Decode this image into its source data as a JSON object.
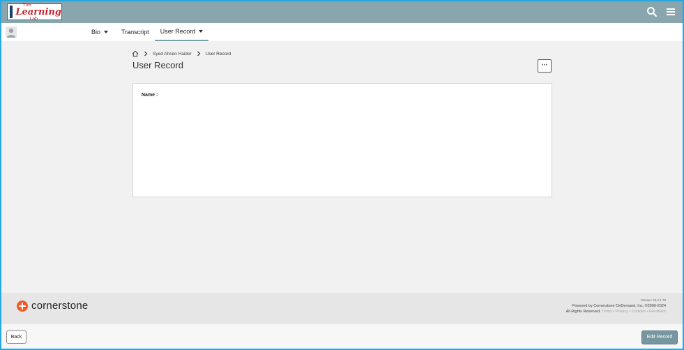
{
  "header": {
    "logo": {
      "line1": "The",
      "line2": "Learning",
      "line3": "Lab"
    },
    "icons": {
      "search": "search-icon",
      "menu": "hamburger-menu-icon"
    },
    "color": "#89a5ae"
  },
  "tabs": [
    {
      "label": "Bio",
      "has_caret": true
    },
    {
      "label": "Transcript",
      "has_caret": false
    },
    {
      "label": "User Record",
      "has_caret": true,
      "active": true
    }
  ],
  "breadcrumb": {
    "home_icon": "home-icon",
    "items": [
      "Syed Ahsen Haider",
      "User Record"
    ]
  },
  "page": {
    "title": "User Record",
    "more_label": "···",
    "name_label": "Name :"
  },
  "footer": {
    "brand": "cornerstone",
    "version": "Version: 24.2.1.70",
    "powered": "Powered by Cornerstone OnDemand, Inc. ©2000-2024",
    "rights": "All Rights Reserved.",
    "links": [
      "Terms",
      "Privacy",
      "Cookies",
      "Feedback"
    ],
    "separator": "•"
  },
  "actions": {
    "back": "Back",
    "edit": "Edit Record"
  },
  "colors": {
    "frame": "#29a8e0",
    "accent": "#7797a0",
    "brand_orange": "#f15a22"
  }
}
